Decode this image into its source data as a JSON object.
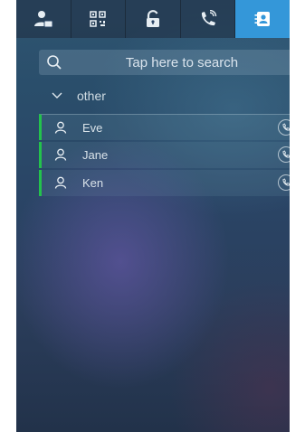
{
  "tabs": [
    {
      "icon": "user-settings-icon",
      "active": false
    },
    {
      "icon": "qr-code-icon",
      "active": false
    },
    {
      "icon": "unlock-icon",
      "active": false
    },
    {
      "icon": "phone-call-icon",
      "active": false
    },
    {
      "icon": "contacts-icon",
      "active": true
    }
  ],
  "search": {
    "placeholder": "Tap here to search",
    "icon": "search-icon"
  },
  "group": {
    "label": "other",
    "icon": "chevron-down-icon"
  },
  "contacts": [
    {
      "name": "Eve",
      "icon": "person-icon",
      "action_icon": "call-icon"
    },
    {
      "name": "Jane",
      "icon": "person-icon",
      "action_icon": "call-icon"
    },
    {
      "name": "Ken",
      "icon": "person-icon",
      "action_icon": "call-icon"
    }
  ],
  "colors": {
    "active_tab": "#3497d9",
    "online_indicator": "#23c24c",
    "background": "#2a4566"
  }
}
